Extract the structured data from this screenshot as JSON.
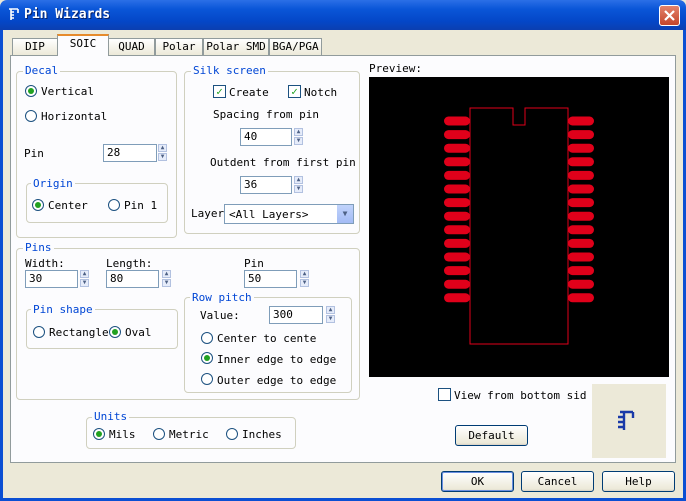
{
  "window": {
    "title": "Pin Wizards",
    "title_icon": "pin-wizard-icon",
    "close_glyph": "✕"
  },
  "tabs": [
    "DIP",
    "SOIC",
    "QUAD",
    "Polar",
    "Polar SMD",
    "BGA/PGA"
  ],
  "active_tab": "SOIC",
  "decal": {
    "legend": "Decal",
    "vertical_label": "Vertical",
    "horizontal_label": "Horizontal",
    "orientation_selected": "Vertical",
    "pin_label": "Pin",
    "pin_value": "28",
    "origin": {
      "legend": "Origin",
      "center_label": "Center",
      "pin1_label": "Pin 1",
      "selected": "Center"
    }
  },
  "silk": {
    "legend": "Silk screen",
    "create_label": "Create",
    "create_checked": true,
    "notch_label": "Notch",
    "notch_checked": true,
    "spacing_label": "Spacing from pin",
    "spacing_value": "40",
    "outdent_label": "Outdent from first pin",
    "outdent_value": "36",
    "layer_label": "Layer",
    "layer_value": "<All Layers>"
  },
  "preview": {
    "label": "Preview:",
    "view_bottom_label": "View from bottom sid",
    "view_bottom_checked": false,
    "pin_count": 28,
    "pad_color": "#e0001a",
    "outline_color": "#e0001a",
    "background": "#000000"
  },
  "pins": {
    "legend": "Pins",
    "width_label": "Width:",
    "width_value": "30",
    "length_label": "Length:",
    "length_value": "80",
    "pin_label": "Pin",
    "pin_value": "50",
    "shape": {
      "legend": "Pin shape",
      "rectangle_label": "Rectangle",
      "oval_label": "Oval",
      "selected": "Oval"
    },
    "row_pitch": {
      "legend": "Row pitch",
      "value_label": "Value:",
      "value": "300",
      "center_label": "Center to cente",
      "inner_label": "Inner edge to edge",
      "outer_label": "Outer edge to edge",
      "selected": "Inner edge to edge"
    }
  },
  "units": {
    "legend": "Units",
    "mils_label": "Mils",
    "metric_label": "Metric",
    "inches_label": "Inches",
    "selected": "Mils"
  },
  "buttons": {
    "default_label": "Default",
    "ok_label": "OK",
    "cancel_label": "Cancel",
    "help_label": "Help"
  },
  "colors": {
    "title_bar": "#0a56d8",
    "accent": "#0046d5",
    "tab_highlight": "#e68b2c"
  }
}
